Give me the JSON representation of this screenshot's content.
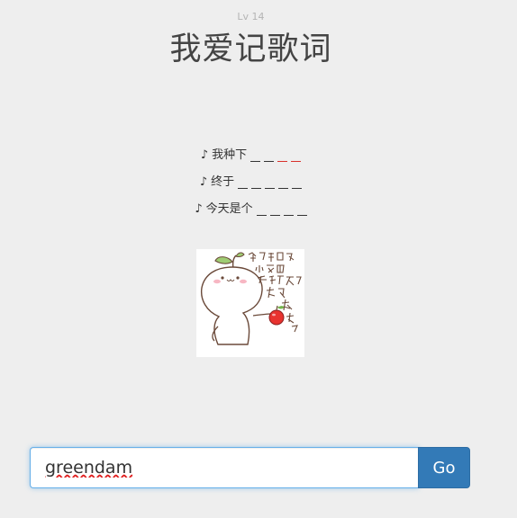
{
  "header": {
    "level": "Lv 14",
    "title": "我爱记歌词"
  },
  "lyrics": [
    {
      "note": "♪",
      "text": "我种下",
      "blanks": [
        "plain",
        "plain",
        "red",
        "red"
      ]
    },
    {
      "note": "♪",
      "text": "终于",
      "blanks": [
        "plain",
        "plain",
        "plain",
        "plain",
        "plain"
      ]
    },
    {
      "note": "♪",
      "text": "今天是个",
      "blanks": [
        "plain",
        "plain",
        "plain",
        "plain"
      ]
    }
  ],
  "illustration": {
    "handwriting": "你是我的小苹果怎么爱你都不嫌多",
    "icon": "sprout-character-holding-apple"
  },
  "answer": {
    "value": "greendam",
    "button_label": "Go"
  },
  "colors": {
    "background": "#eeeeee",
    "title": "#444444",
    "level": "#b4b4b4",
    "blank_highlight": "#d9302b",
    "button": "#337ab7",
    "input_focus": "#66afe9"
  }
}
